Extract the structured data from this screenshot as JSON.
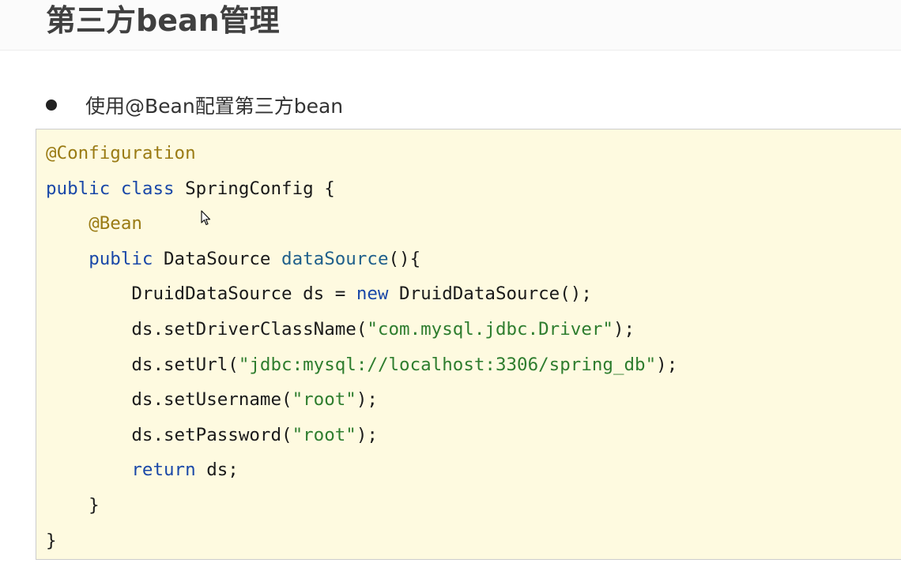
{
  "header": {
    "title": "第三方bean管理"
  },
  "bullet": {
    "text": "使用@Bean配置第三方bean"
  },
  "code": {
    "lines": [
      {
        "segments": [
          {
            "t": "@Configuration",
            "c": "annotation"
          }
        ]
      },
      {
        "segments": [
          {
            "t": "public",
            "c": "keyword"
          },
          {
            "t": " ",
            "c": "plain"
          },
          {
            "t": "class",
            "c": "keyword"
          },
          {
            "t": " SpringConfig {",
            "c": "plain"
          }
        ]
      },
      {
        "segments": [
          {
            "t": "    ",
            "c": "plain"
          },
          {
            "t": "@Bean",
            "c": "annotation"
          }
        ]
      },
      {
        "segments": [
          {
            "t": "    ",
            "c": "plain"
          },
          {
            "t": "public",
            "c": "keyword"
          },
          {
            "t": " DataSource ",
            "c": "plain"
          },
          {
            "t": "dataSource",
            "c": "method-name"
          },
          {
            "t": "(){",
            "c": "plain"
          }
        ]
      },
      {
        "segments": [
          {
            "t": "        DruidDataSource ds = ",
            "c": "plain"
          },
          {
            "t": "new",
            "c": "keyword"
          },
          {
            "t": " DruidDataSource();",
            "c": "plain"
          }
        ]
      },
      {
        "segments": [
          {
            "t": "        ds.setDriverClassName(",
            "c": "plain"
          },
          {
            "t": "\"com.mysql.jdbc.Driver\"",
            "c": "string-lit"
          },
          {
            "t": ");",
            "c": "plain"
          }
        ]
      },
      {
        "segments": [
          {
            "t": "        ds.setUrl(",
            "c": "plain"
          },
          {
            "t": "\"jdbc:mysql://localhost:3306/spring_db\"",
            "c": "string-lit"
          },
          {
            "t": ");",
            "c": "plain"
          }
        ]
      },
      {
        "segments": [
          {
            "t": "        ds.setUsername(",
            "c": "plain"
          },
          {
            "t": "\"root\"",
            "c": "string-lit"
          },
          {
            "t": ");",
            "c": "plain"
          }
        ]
      },
      {
        "segments": [
          {
            "t": "        ds.setPassword(",
            "c": "plain"
          },
          {
            "t": "\"root\"",
            "c": "string-lit"
          },
          {
            "t": ");",
            "c": "plain"
          }
        ]
      },
      {
        "segments": [
          {
            "t": "        ",
            "c": "plain"
          },
          {
            "t": "return",
            "c": "keyword"
          },
          {
            "t": " ds;",
            "c": "plain"
          }
        ]
      },
      {
        "segments": [
          {
            "t": "    }",
            "c": "plain"
          }
        ]
      },
      {
        "segments": [
          {
            "t": "}",
            "c": "plain"
          }
        ]
      }
    ]
  },
  "colors": {
    "code_background": "#fefae0",
    "annotation": "#9a7b14",
    "keyword": "#1a48a8",
    "method": "#1f5f8b",
    "string": "#2e7d2e",
    "title_text": "#404040"
  },
  "icons": {
    "cursor": "mouse-pointer-icon"
  }
}
